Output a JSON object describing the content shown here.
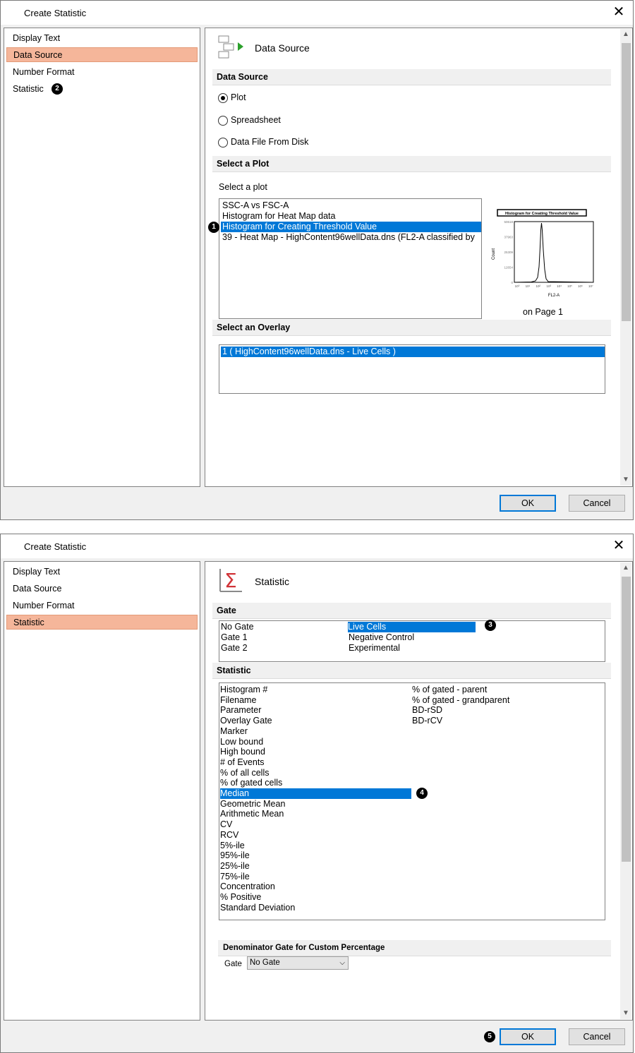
{
  "dialog_title": "Create Statistic",
  "nav": [
    "Display Text",
    "Data Source",
    "Number Format",
    "Statistic"
  ],
  "top": {
    "header": "Data Source",
    "data_source_section": "Data Source",
    "radios": [
      "Plot",
      "Spreadsheet",
      "Data File From Disk"
    ],
    "select_plot_section": "Select a Plot",
    "select_plot_label": "Select a plot",
    "plots": [
      "SSC-A vs FSC-A",
      "Histogram for Heat Map data",
      "Histogram for Creating Threshold Value",
      "39 - Heat Map - HighContent96wellData.dns (FL2-A classified by"
    ],
    "preview": {
      "title": "Histogram for Creating Threshold Value",
      "ylabel": "Count",
      "xlabel": "FL2-A",
      "yticks": [
        "50618",
        "37963",
        "25309",
        "12654",
        "0"
      ],
      "xticks": [
        "10⁰",
        "10¹",
        "10²",
        "10³",
        "10⁴",
        "10⁵",
        "10⁶",
        "10⁷"
      ],
      "caption": "on Page 1"
    },
    "overlay_section": "Select an Overlay",
    "overlays": [
      "1 ( HighContent96wellData.dns - Live Cells )"
    ]
  },
  "bottom": {
    "header": "Statistic",
    "gate_section": "Gate",
    "gates_col1": [
      "No Gate",
      "Gate 1",
      "Gate 2"
    ],
    "gates_col2": [
      "Live Cells",
      "Negative Control",
      "Experimental"
    ],
    "statistic_section": "Statistic",
    "stats_col1": [
      "Histogram #",
      "Filename",
      "Parameter",
      "Overlay Gate",
      "Marker",
      "Low bound",
      "High bound",
      "# of Events",
      "% of all cells",
      "% of gated cells",
      "Median",
      "Geometric Mean",
      "Arithmetic Mean",
      "CV",
      "RCV",
      "5%-ile",
      "95%-ile",
      "25%-ile",
      "75%-ile",
      "Concentration",
      "% Positive",
      "Standard Deviation"
    ],
    "stats_col2": [
      "% of gated - parent",
      "% of gated - grandparent",
      "BD-rSD",
      "BD-rCV"
    ],
    "denominator_section": "Denominator Gate for Custom Percentage",
    "gate_label": "Gate",
    "gate_select": "No Gate"
  },
  "buttons": {
    "ok": "OK",
    "cancel": "Cancel"
  },
  "badges": [
    "1",
    "2",
    "3",
    "4",
    "5"
  ],
  "colors": {
    "selection": "#0078d7",
    "nav_selected": "#f5b69a",
    "arrow_green": "#2ca02c",
    "sigma_red": "#d13438"
  }
}
